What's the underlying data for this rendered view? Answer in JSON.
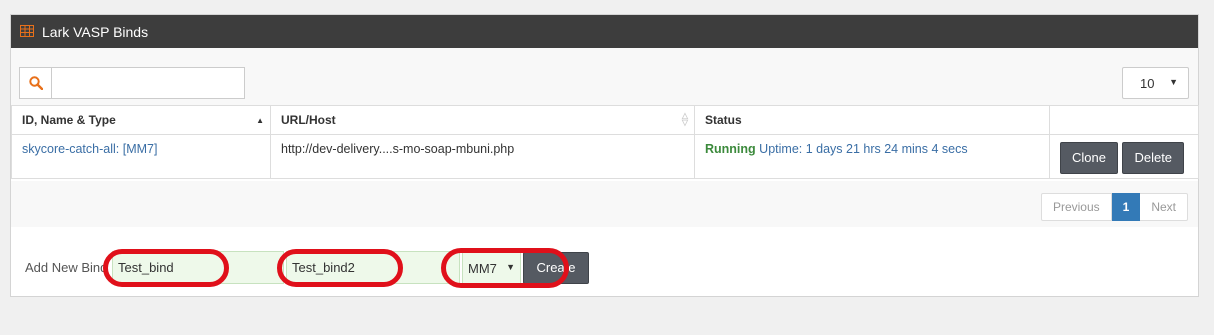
{
  "panel": {
    "title": "Lark VASP Binds"
  },
  "search": {
    "value": "",
    "placeholder": ""
  },
  "page_size": {
    "value": "10"
  },
  "table": {
    "headers": {
      "id_name_type": "ID, Name & Type",
      "url_host": "URL/Host",
      "status": "Status"
    },
    "rows": [
      {
        "id_name_type": "skycore-catch-all: [MM7]",
        "url_host": "http://dev-delivery....s-mo-soap-mbuni.php",
        "status_state": "Running",
        "status_uptime": "Uptime: 1 days 21 hrs 24 mins 4 secs",
        "clone_label": "Clone",
        "delete_label": "Delete"
      }
    ]
  },
  "pagination": {
    "previous": "Previous",
    "current": "1",
    "next": "Next"
  },
  "add_bind": {
    "label": "Add New Bind",
    "name_value": "Test_bind",
    "host_value": "Test_bind2",
    "type_value": "MM7",
    "create_label": "Create"
  },
  "colors": {
    "header_bg": "#3d3d3d",
    "accent_orange": "#e8701a",
    "link_blue": "#3a6ea5",
    "running_green": "#3c8a3c",
    "annotation_red": "#e0101a"
  }
}
